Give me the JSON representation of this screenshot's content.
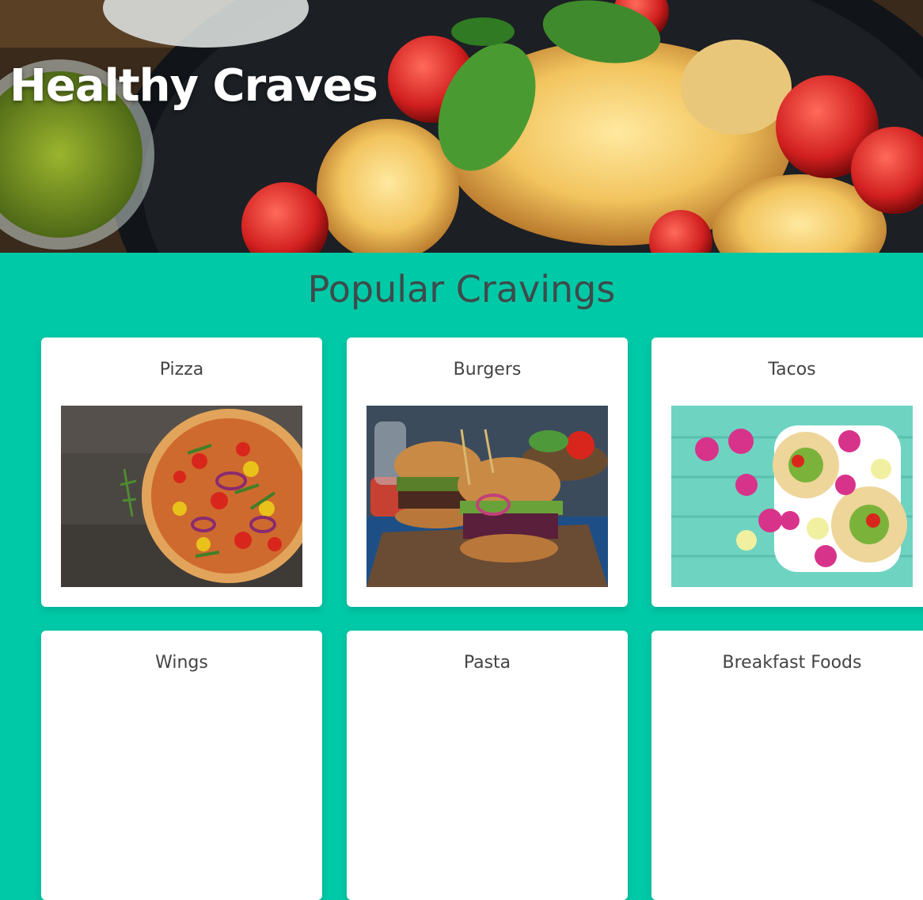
{
  "header": {
    "site_title": "Healthy Craves",
    "hero_image": "roasted chicken with melted cheese, tomatoes, basil and pesto"
  },
  "main": {
    "section_title": "Popular Cravings",
    "cards": [
      {
        "label": "Pizza",
        "image": "pizza-photo"
      },
      {
        "label": "Burgers",
        "image": "burgers-photo"
      },
      {
        "label": "Tacos",
        "image": "tacos-photo"
      },
      {
        "label": "Wings",
        "image": ""
      },
      {
        "label": "Pasta",
        "image": ""
      },
      {
        "label": "Breakfast Foods",
        "image": ""
      }
    ]
  },
  "colors": {
    "background": "#00c9a7",
    "card": "#ffffff",
    "heading": "#3d4b4b"
  }
}
